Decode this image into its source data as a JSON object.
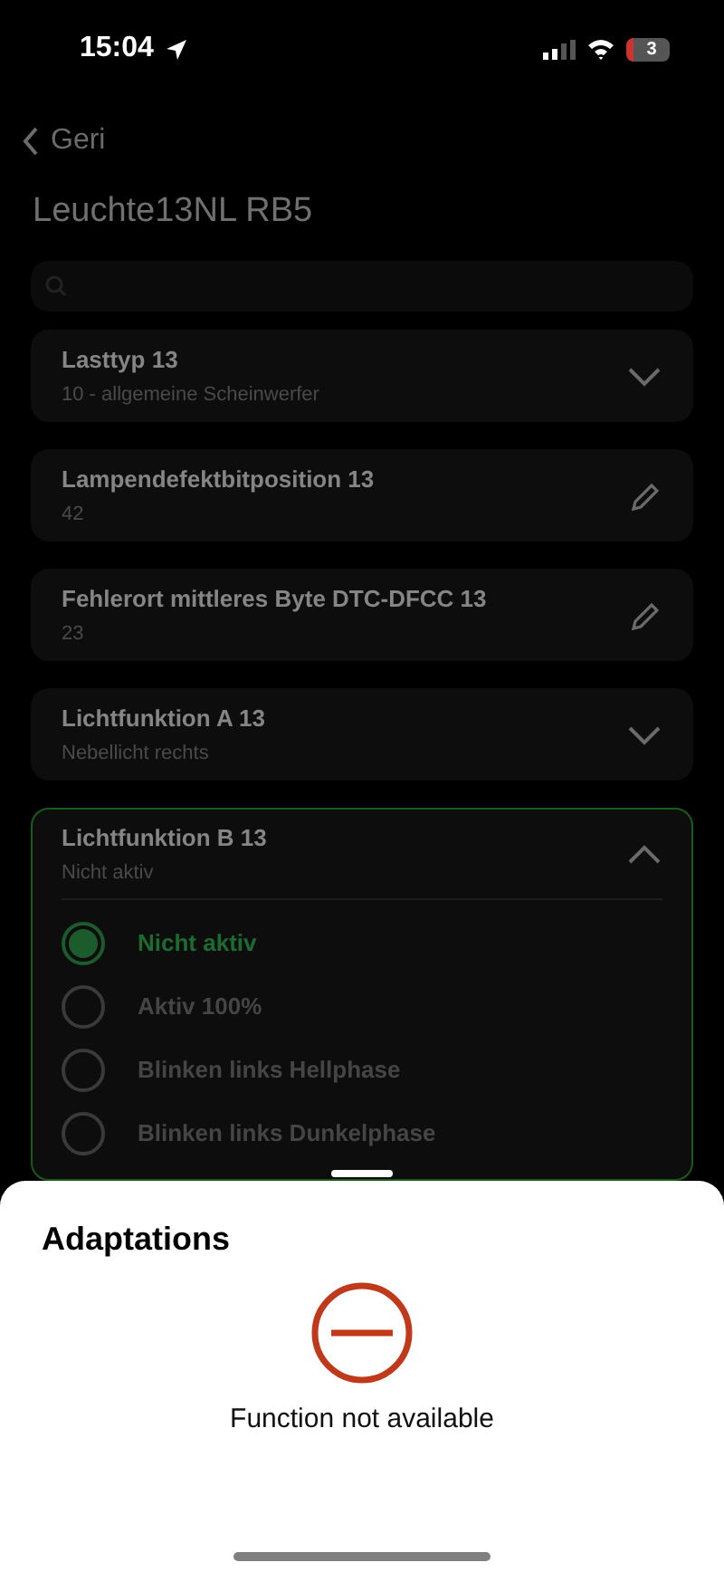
{
  "status_bar": {
    "time": "15:04",
    "battery": "3"
  },
  "nav": {
    "back": "Geri"
  },
  "title": "Leuchte13NL RB5",
  "search": {
    "icon": true
  },
  "parameters": [
    {
      "kind": "dropdown",
      "name": "Lasttyp 13",
      "value": "10 - allgemeine Scheinwerfer",
      "expanded": false
    },
    {
      "kind": "edit",
      "name": "Lampendefektbitposition 13",
      "value": "42"
    },
    {
      "kind": "edit",
      "name": "Fehlerort mittleres Byte DTC-DFCC 13",
      "value": "23"
    },
    {
      "kind": "dropdown",
      "name": "Lichtfunktion A 13",
      "value": "Nebellicht rechts",
      "expanded": false
    },
    {
      "kind": "dropdown",
      "name": "Lichtfunktion B 13",
      "value": "Nicht aktiv",
      "expanded": true,
      "options": [
        {
          "label": "Nicht aktiv",
          "selected": true
        },
        {
          "label": "Aktiv 100%",
          "selected": false
        },
        {
          "label": "Blinken links Hellphase",
          "selected": false
        },
        {
          "label": "Blinken links Dunkelphase",
          "selected": false
        }
      ]
    }
  ],
  "sheet": {
    "title": "Adaptations",
    "message": "Function not available"
  }
}
